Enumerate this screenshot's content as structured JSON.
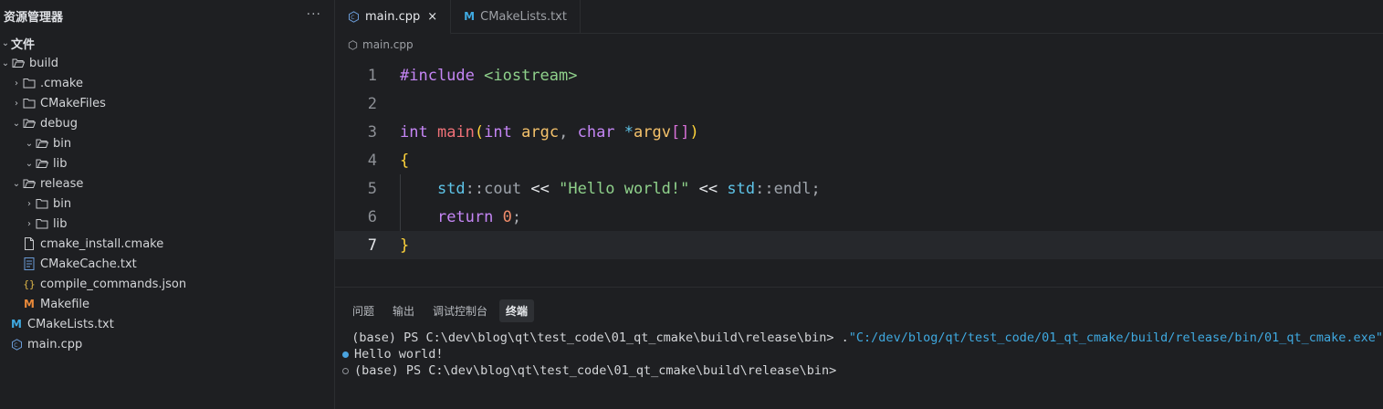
{
  "sidebar": {
    "title": "资源管理器",
    "more": "···",
    "section": "文件",
    "items": [
      {
        "label": "build",
        "icon": "folder-open-icon",
        "chevron": "v"
      },
      {
        "label": ".cmake",
        "icon": "folder-icon",
        "chevron": ">"
      },
      {
        "label": "CMakeFiles",
        "icon": "folder-icon",
        "chevron": ">"
      },
      {
        "label": "debug",
        "icon": "folder-open-icon",
        "chevron": "v"
      },
      {
        "label": "bin",
        "icon": "folder-open-icon",
        "chevron": "v"
      },
      {
        "label": "lib",
        "icon": "folder-open-icon",
        "chevron": "v"
      },
      {
        "label": "release",
        "icon": "folder-open-icon",
        "chevron": "v"
      },
      {
        "label": "bin",
        "icon": "folder-icon",
        "chevron": ">"
      },
      {
        "label": "lib",
        "icon": "folder-icon",
        "chevron": ">"
      },
      {
        "label": "cmake_install.cmake",
        "icon": "file-icon"
      },
      {
        "label": "CMakeCache.txt",
        "icon": "text-file-icon"
      },
      {
        "label": "compile_commands.json",
        "icon": "json-icon"
      },
      {
        "label": "Makefile",
        "icon": "makefile-icon"
      },
      {
        "label": "CMakeLists.txt",
        "icon": "cmake-icon"
      },
      {
        "label": "main.cpp",
        "icon": "cpp-icon"
      }
    ]
  },
  "editor": {
    "tabs": [
      {
        "label": "main.cpp",
        "icon": "cpp-icon",
        "close": "×"
      },
      {
        "label": "CMakeLists.txt",
        "icon": "cmake-icon"
      }
    ],
    "breadcrumb": "main.cpp",
    "line_numbers": [
      "1",
      "2",
      "3",
      "4",
      "5",
      "6",
      "7"
    ],
    "code": {
      "l1_kw": "#include",
      "l1_hdr": "<iostream>",
      "l3_t1": "int",
      "l3_fn": "main",
      "l3_p1": "(",
      "l3_t2": "int",
      "l3_v1": "argc",
      "l3_c": ",",
      "l3_t3": "char",
      "l3_star": "*",
      "l3_v2": "argv",
      "l3_br": "[]",
      "l3_p2": ")",
      "l4": "{",
      "l5_ns1": "std",
      "l5_sep1": "::",
      "l5_id1": "cout",
      "l5_op1": "<<",
      "l5_str": "\"Hello world!\"",
      "l5_op2": "<<",
      "l5_ns2": "std",
      "l5_sep2": "::",
      "l5_id2": "endl",
      "l5_semi": ";",
      "l6_kw": "return",
      "l6_num": "0",
      "l6_semi": ";",
      "l7": "}"
    }
  },
  "panel": {
    "tabs": [
      "问题",
      "输出",
      "调试控制台",
      "终端"
    ],
    "active_tab": "终端",
    "terminal": {
      "line1_prompt": "(base) PS C:\\dev\\blog\\qt\\test_code\\01_qt_cmake\\build\\release\\bin> .",
      "line1_path": "\"C:/dev/blog/qt/test_code/01_qt_cmake/build/release/bin/01_qt_cmake.exe\"",
      "line2": "Hello world!",
      "line3": "(base) PS C:\\dev\\blog\\qt\\test_code\\01_qt_cmake\\build\\release\\bin>"
    }
  },
  "colors": {
    "background": "#1e1f22",
    "keyword": "#c586f5",
    "string": "#8fd18b",
    "accent": "#3fa9e0"
  }
}
